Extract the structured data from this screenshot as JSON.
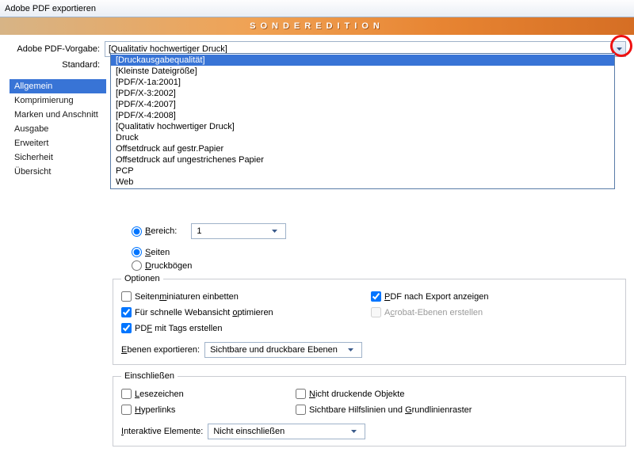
{
  "window": {
    "title": "Adobe PDF exportieren",
    "banner": "SONDEREDITION"
  },
  "topcombo": {
    "label": "Adobe PDF-Vorgabe:",
    "value": "[Qualitativ hochwertiger Druck]"
  },
  "standard": {
    "label": "Standard:"
  },
  "sidebar": {
    "items": [
      "Allgemein",
      "Komprimierung",
      "Marken und Anschnitt",
      "Ausgabe",
      "Erweitert",
      "Sicherheit",
      "Übersicht"
    ],
    "selected": 0
  },
  "dropdown": {
    "items": [
      "[Druckausgabequalität]",
      "[Kleinste Dateigröße]",
      "[PDF/X-1a:2001]",
      "[PDF/X-3:2002]",
      "[PDF/X-4:2007]",
      "[PDF/X-4:2008]",
      "[Qualitativ hochwertiger Druck]",
      "Druck",
      "Offsetdruck auf gestr.Papier",
      "Offsetdruck auf ungestrichenes Papier",
      "PCP",
      "Web"
    ],
    "highlighted": 0
  },
  "pages": {
    "mode_bereich": "Bereich:",
    "bereich_value": "1",
    "mode_seiten": "Seiten",
    "mode_druckbogen": "Druckbögen"
  },
  "options": {
    "legend": "Optionen",
    "miniaturen": "Seitenminiaturen einbetten",
    "webansicht": "Für schnelle Webansicht optimieren",
    "tags": "PDF mit Tags erstellen",
    "pdfnachexport": "PDF nach Export anzeigen",
    "acrobat": "Acrobat-Ebenen erstellen",
    "ebenen_label": "Ebenen exportieren:",
    "ebenen_value": "Sichtbare und druckbare Ebenen"
  },
  "include": {
    "legend": "Einschließen",
    "lesezeichen": "Lesezeichen",
    "hyperlinks": "Hyperlinks",
    "nichtdruck": "Nicht druckende Objekte",
    "hilfslinien": "Sichtbare Hilfslinien und Grundlinienraster",
    "inter_label": "Interaktive Elemente:",
    "inter_value": "Nicht einschließen"
  }
}
